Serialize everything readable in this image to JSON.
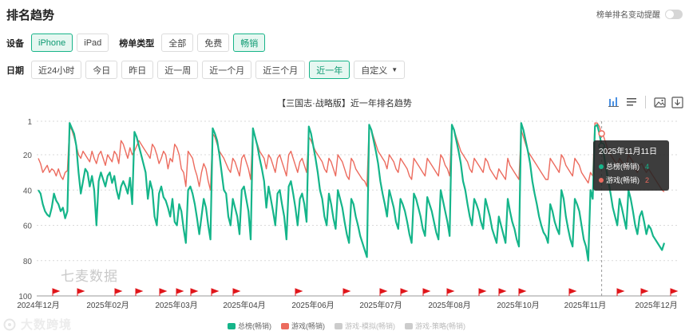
{
  "page": {
    "title": "排名趋势"
  },
  "alert_toggle": {
    "label": "榜单排名变动提醒",
    "on": false
  },
  "filters": {
    "device_label": "设备",
    "devices": [
      {
        "label": "iPhone",
        "active": true
      },
      {
        "label": "iPad",
        "active": false
      }
    ],
    "list_type_label": "榜单类型",
    "list_types": [
      {
        "label": "全部",
        "active": false
      },
      {
        "label": "免费",
        "active": false
      },
      {
        "label": "畅销",
        "active": true
      }
    ],
    "date_label": "日期",
    "dates": [
      {
        "label": "近24小时",
        "active": false
      },
      {
        "label": "今日",
        "active": false
      },
      {
        "label": "昨日",
        "active": false
      },
      {
        "label": "近一周",
        "active": false
      },
      {
        "label": "近一个月",
        "active": false
      },
      {
        "label": "近三个月",
        "active": false
      },
      {
        "label": "近一年",
        "active": true
      }
    ],
    "custom_label": "自定义"
  },
  "toolbar": {
    "icons": [
      "bar-view-icon",
      "list-view-icon",
      "image-download-icon",
      "export-icon"
    ]
  },
  "watermark": "七麦数据",
  "corner_logo": "大数跨境",
  "colors": {
    "accent": "#18b489",
    "total_line": "#15b58a",
    "game_line": "#ec6b5e",
    "grid": "#d9d9d9",
    "marker": "#e0161b"
  },
  "tooltip": {
    "date": "2025年11月11日",
    "rows": [
      {
        "name": "总榜(畅销)",
        "value": "4",
        "color": "#15b58a"
      },
      {
        "name": "游戏(畅销)",
        "value": "2",
        "color": "#ec6b5e"
      }
    ]
  },
  "chart_data": {
    "type": "line",
    "title": "【三国志·战略版】近一年排名趋势",
    "y_axis": {
      "inverted": true,
      "ylim": [
        1,
        100
      ],
      "ticks": [
        1,
        20,
        40,
        60,
        80,
        100
      ]
    },
    "x_axis": {
      "ticks": [
        "2024年12月",
        "2025年02月",
        "2025年03月",
        "2025年04月",
        "2025年06月",
        "2025年07月",
        "2025年08月",
        "2025年10月",
        "2025年11月",
        "2025年12月"
      ]
    },
    "grid": "horizontal dashed",
    "legend": [
      "总榜(畅销)",
      "游戏(畅销)",
      "游戏-模拟(畅销)",
      "游戏-策略(畅销)"
    ],
    "legend_placement": "bottom-center",
    "series": [
      {
        "name": "总榜(畅销)",
        "values": [
          40,
          42,
          48,
          52,
          54,
          55,
          50,
          42,
          46,
          48,
          52,
          50,
          56,
          52,
          2,
          5,
          8,
          15,
          30,
          42,
          35,
          28,
          30,
          38,
          32,
          40,
          60,
          35,
          30,
          34,
          38,
          32,
          30,
          36,
          32,
          40,
          45,
          38,
          35,
          38,
          42,
          33,
          48,
          7,
          10,
          15,
          20,
          25,
          30,
          45,
          35,
          40,
          55,
          60,
          42,
          38,
          44,
          46,
          50,
          55,
          45,
          58,
          60,
          48,
          52,
          62,
          70,
          40,
          38,
          42,
          48,
          56,
          65,
          55,
          45,
          50,
          60,
          68,
          5,
          8,
          12,
          20,
          30,
          40,
          42,
          55,
          60,
          45,
          50,
          55,
          65,
          40,
          38,
          45,
          52,
          68,
          5,
          10,
          15,
          22,
          28,
          35,
          50,
          38,
          45,
          52,
          60,
          42,
          40,
          48,
          55,
          68,
          38,
          35,
          42,
          50,
          60,
          45,
          42,
          48,
          58,
          4,
          8,
          15,
          22,
          30,
          40,
          45,
          55,
          60,
          42,
          48,
          56,
          62,
          40,
          45,
          50,
          58,
          65,
          70,
          45,
          48,
          55,
          60,
          66,
          70,
          74,
          78,
          3,
          6,
          12,
          18,
          25,
          35,
          42,
          48,
          55,
          40,
          45,
          50,
          58,
          62,
          45,
          48,
          52,
          58,
          65,
          70,
          42,
          45,
          50,
          55,
          62,
          66,
          44,
          48,
          52,
          58,
          64,
          68,
          40,
          46,
          52,
          58,
          66,
          3,
          6,
          12,
          18,
          25,
          35,
          40,
          48,
          55,
          60,
          45,
          48,
          52,
          58,
          62,
          45,
          50,
          55,
          62,
          66,
          70,
          55,
          60,
          65,
          70,
          45,
          52,
          58,
          62,
          68,
          72,
          2,
          6,
          12,
          18,
          25,
          35,
          42,
          48,
          55,
          60,
          64,
          66,
          70,
          48,
          52,
          58,
          62,
          65,
          40,
          45,
          55,
          62,
          68,
          72,
          45,
          48,
          52,
          60,
          68,
          72,
          80,
          40,
          45,
          4,
          3,
          8,
          15,
          20,
          28,
          35,
          42,
          50,
          55,
          60,
          45,
          50,
          56,
          62,
          40,
          45,
          52,
          60,
          65,
          55,
          52,
          58,
          65,
          60,
          62,
          66,
          68,
          70,
          72,
          74,
          70
        ]
      },
      {
        "name": "游戏(畅销)",
        "values": [
          22,
          25,
          30,
          28,
          26,
          30,
          28,
          29,
          32,
          28,
          32,
          34,
          30,
          29,
          4,
          6,
          10,
          15,
          20,
          22,
          18,
          20,
          22,
          24,
          18,
          22,
          25,
          20,
          18,
          22,
          26,
          20,
          22,
          24,
          18,
          20,
          25,
          12,
          14,
          18,
          22,
          16,
          20,
          18,
          15,
          12,
          14,
          16,
          18,
          20,
          22,
          14,
          16,
          20,
          25,
          22,
          18,
          20,
          28,
          22,
          24,
          14,
          16,
          20,
          28,
          30,
          38,
          18,
          20,
          22,
          28,
          32,
          38,
          30,
          25,
          28,
          35,
          40,
          8,
          10,
          14,
          18,
          20,
          22,
          25,
          28,
          30,
          22,
          24,
          28,
          32,
          22,
          20,
          24,
          28,
          34,
          6,
          10,
          14,
          18,
          20,
          22,
          28,
          20,
          22,
          26,
          30,
          22,
          20,
          24,
          28,
          32,
          20,
          18,
          22,
          26,
          30,
          24,
          22,
          26,
          30,
          10,
          12,
          15,
          18,
          20,
          22,
          24,
          28,
          30,
          22,
          24,
          28,
          32,
          20,
          22,
          24,
          28,
          32,
          34,
          22,
          24,
          28,
          30,
          32,
          34,
          35,
          38,
          4,
          6,
          10,
          14,
          18,
          20,
          22,
          24,
          28,
          20,
          22,
          24,
          28,
          30,
          22,
          24,
          26,
          28,
          32,
          34,
          22,
          24,
          26,
          28,
          30,
          32,
          22,
          24,
          26,
          28,
          30,
          32,
          20,
          22,
          26,
          28,
          32,
          4,
          6,
          10,
          14,
          18,
          20,
          22,
          24,
          28,
          30,
          22,
          24,
          26,
          28,
          30,
          22,
          24,
          28,
          30,
          32,
          34,
          28,
          30,
          32,
          34,
          22,
          26,
          28,
          30,
          32,
          34,
          6,
          10,
          14,
          18,
          20,
          22,
          24,
          26,
          28,
          30,
          32,
          34,
          34,
          22,
          24,
          26,
          28,
          30,
          20,
          22,
          26,
          28,
          30,
          32,
          22,
          24,
          26,
          30,
          32,
          34,
          36,
          30,
          32,
          2,
          2,
          4,
          8,
          10,
          14,
          18,
          20,
          22,
          24,
          26,
          22,
          24,
          26,
          28,
          20,
          22,
          24,
          28,
          30,
          26,
          25,
          28,
          30,
          28,
          30,
          32,
          34,
          36,
          38,
          40,
          41
        ]
      },
      {
        "name": "游戏-模拟(畅销)",
        "values": []
      },
      {
        "name": "游戏-策略(畅销)",
        "values": []
      }
    ],
    "hover_index": 252,
    "markers": {
      "count": 22,
      "description": "red flag event markers along the x-axis baseline"
    }
  }
}
